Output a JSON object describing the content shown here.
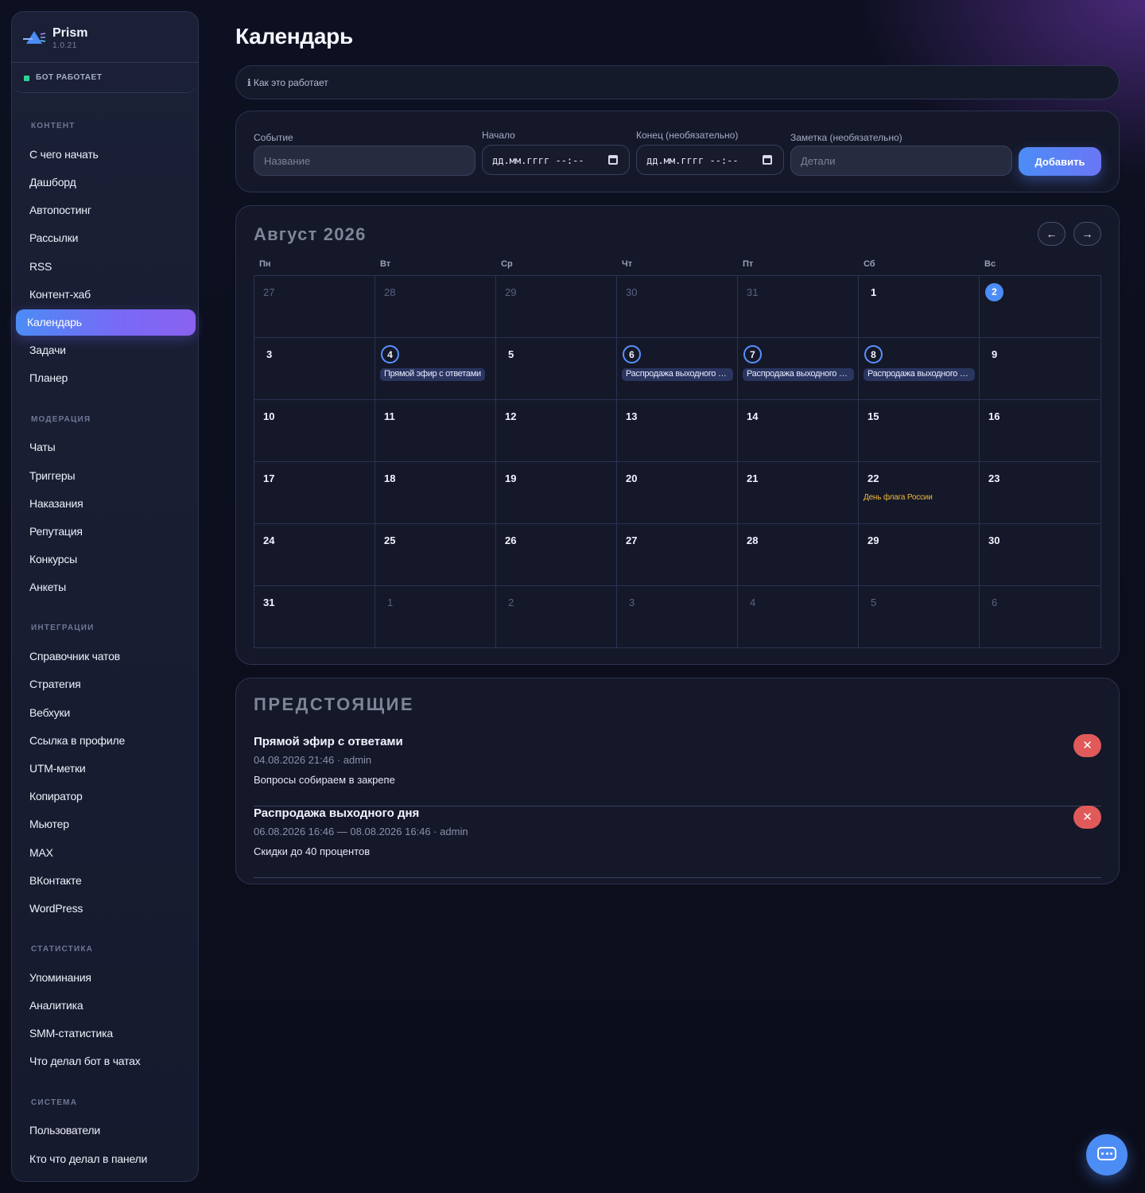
{
  "app": {
    "name": "Prism",
    "version": "1.0.21",
    "status": "БОТ РАБОТАЕТ"
  },
  "sidebar": {
    "sections": [
      {
        "label": "КОНТЕНТ",
        "items": [
          "С чего начать",
          "Дашборд",
          "Автопостинг",
          "Рассылки",
          "RSS",
          "Контент-хаб",
          "Календарь",
          "Задачи",
          "Планер"
        ]
      },
      {
        "label": "МОДЕРАЦИЯ",
        "items": [
          "Чаты",
          "Триггеры",
          "Наказания",
          "Репутация",
          "Конкурсы",
          "Анкеты"
        ]
      },
      {
        "label": "ИНТЕГРАЦИИ",
        "items": [
          "Справочник чатов",
          "Стратегия",
          "Вебхуки",
          "Ссылка в профиле",
          "UTM-метки",
          "Копиратор",
          "Мьютер",
          "MAX",
          "ВКонтакте",
          "WordPress"
        ]
      },
      {
        "label": "СТАТИСТИКА",
        "items": [
          "Упоминания",
          "Аналитика",
          "SMM-статистика",
          "Что делал бот в чатах"
        ]
      },
      {
        "label": "СИСТЕМА",
        "items": [
          "Пользователи",
          "Кто что делал в панели"
        ]
      }
    ],
    "active_item": "Календарь"
  },
  "page": {
    "title": "Календарь",
    "howto": "ℹ Как это работает"
  },
  "form": {
    "event_label": "Событие",
    "event_placeholder": "Название",
    "start_label": "Начало",
    "start_value": "дд.мм.гггг --:--",
    "end_label": "Конец (необязательно)",
    "end_value": "дд.мм.гггг --:--",
    "note_label": "Заметка (необязательно)",
    "note_placeholder": "Детали",
    "add_button": "Добавить"
  },
  "calendar": {
    "month": "Август 2026",
    "prev_label": "←",
    "next_label": "→",
    "weekdays": [
      "Пн",
      "Вт",
      "Ср",
      "Чт",
      "Пт",
      "Сб",
      "Вс"
    ],
    "weeks": [
      [
        {
          "day": "27",
          "muted": true
        },
        {
          "day": "28",
          "muted": true
        },
        {
          "day": "29",
          "muted": true
        },
        {
          "day": "30",
          "muted": true
        },
        {
          "day": "31",
          "muted": true
        },
        {
          "day": "1"
        },
        {
          "day": "2",
          "today": true
        }
      ],
      [
        {
          "day": "3"
        },
        {
          "day": "4",
          "event": "Прямой эфир с ответами"
        },
        {
          "day": "5"
        },
        {
          "day": "6",
          "event": "Распродажа выходного дня"
        },
        {
          "day": "7",
          "event": "Распродажа выходного дня"
        },
        {
          "day": "8",
          "event": "Распродажа выходного дня"
        },
        {
          "day": "9"
        }
      ],
      [
        {
          "day": "10"
        },
        {
          "day": "11"
        },
        {
          "day": "12"
        },
        {
          "day": "13"
        },
        {
          "day": "14"
        },
        {
          "day": "15"
        },
        {
          "day": "16"
        }
      ],
      [
        {
          "day": "17"
        },
        {
          "day": "18"
        },
        {
          "day": "19"
        },
        {
          "day": "20"
        },
        {
          "day": "21"
        },
        {
          "day": "22",
          "holiday": "День флага России"
        },
        {
          "day": "23"
        }
      ],
      [
        {
          "day": "24"
        },
        {
          "day": "25"
        },
        {
          "day": "26"
        },
        {
          "day": "27"
        },
        {
          "day": "28"
        },
        {
          "day": "29"
        },
        {
          "day": "30"
        }
      ],
      [
        {
          "day": "31"
        },
        {
          "day": "1",
          "muted": true
        },
        {
          "day": "2",
          "muted": true
        },
        {
          "day": "3",
          "muted": true
        },
        {
          "day": "4",
          "muted": true
        },
        {
          "day": "5",
          "muted": true
        },
        {
          "day": "6",
          "muted": true
        }
      ]
    ]
  },
  "upcoming": {
    "title": "ПРЕДСТОЯЩИЕ",
    "items": [
      {
        "title": "Прямой эфир с ответами",
        "meta": "04.08.2026 21:46 · admin",
        "note": "Вопросы собираем в закрепе",
        "delete_label": "✕"
      },
      {
        "title": "Распродажа выходного дня",
        "meta": "06.08.2026 16:46 — 08.08.2026 16:46 · admin",
        "note": "Скидки до 40 процентов",
        "delete_label": "✕"
      }
    ]
  },
  "colors": {
    "accent": "#4c8cf5",
    "accent_2": "#8a62f0",
    "danger": "#e05a5a",
    "holiday": "#f0b83c",
    "status_ok": "#2fd39a"
  },
  "icons": {
    "logo": "prism-logo-icon",
    "chat": "chat-bubble-icon",
    "calendar": "calendar-icon",
    "delete": "close-icon"
  }
}
